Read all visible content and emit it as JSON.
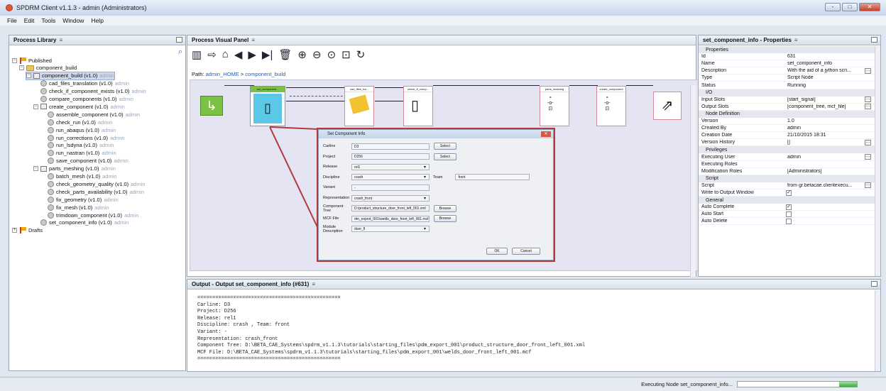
{
  "window": {
    "title": "SPDRM Client v1.1.3 - admin (Administrators)",
    "controls": [
      "-",
      "□",
      "✕"
    ]
  },
  "menu": [
    "File",
    "Edit",
    "Tools",
    "Window",
    "Help"
  ],
  "library": {
    "title": "Process Library",
    "close": "≡",
    "search_icon": "search-icon",
    "tree": [
      {
        "label": "Published",
        "icon": "flag",
        "depth": 0,
        "tog": "−"
      },
      {
        "label": "component_build",
        "icon": "folder",
        "depth": 1,
        "tog": "−"
      },
      {
        "label": "component_build (v1.0)",
        "user": "admin",
        "icon": "proc",
        "depth": 2,
        "tog": "−",
        "selected": true
      },
      {
        "label": "cad_files_translation (v1.0)",
        "user": "admin",
        "icon": "gear",
        "depth": 3
      },
      {
        "label": "check_if_component_exists (v1.0)",
        "user": "admin",
        "icon": "gear",
        "depth": 3
      },
      {
        "label": "compare_components (v1.0)",
        "user": "admin",
        "icon": "gear",
        "depth": 3
      },
      {
        "label": "create_component (v1.0)",
        "user": "admin",
        "icon": "proc",
        "depth": 3,
        "tog": "−"
      },
      {
        "label": "assemble_component (v1.0)",
        "user": "admin",
        "icon": "gear",
        "depth": 4
      },
      {
        "label": "check_run (v1.0)",
        "user": "admin",
        "icon": "gear",
        "depth": 4
      },
      {
        "label": "run_abaqus (v1.0)",
        "user": "admin",
        "icon": "gear",
        "depth": 4
      },
      {
        "label": "run_corrections (v1.0)",
        "user": "admin",
        "icon": "gear",
        "depth": 4
      },
      {
        "label": "run_lsdyna (v1.0)",
        "user": "admin",
        "icon": "gear",
        "depth": 4
      },
      {
        "label": "run_nastran (v1.0)",
        "user": "admin",
        "icon": "gear",
        "depth": 4
      },
      {
        "label": "save_component (v1.0)",
        "user": "admin",
        "icon": "gear",
        "depth": 4
      },
      {
        "label": "parts_meshing (v1.0)",
        "user": "admin",
        "icon": "proc",
        "depth": 3,
        "tog": "−"
      },
      {
        "label": "batch_mesh (v1.0)",
        "user": "admin",
        "icon": "gear",
        "depth": 4
      },
      {
        "label": "check_geometry_quality (v1.0)",
        "user": "admin",
        "icon": "gear",
        "depth": 4
      },
      {
        "label": "check_parts_availability (v1.0)",
        "user": "admin",
        "icon": "gear",
        "depth": 4
      },
      {
        "label": "fix_geometry (v1.0)",
        "user": "admin",
        "icon": "gear",
        "depth": 4
      },
      {
        "label": "fix_mesh (v1.0)",
        "user": "admin",
        "icon": "gear",
        "depth": 4
      },
      {
        "label": "trimdown_component (v1.0)",
        "user": "admin",
        "icon": "gear",
        "depth": 4
      },
      {
        "label": "set_component_info (v1.0)",
        "user": "admin",
        "icon": "gear",
        "depth": 3
      },
      {
        "label": "Drafts",
        "icon": "flag",
        "depth": 0,
        "tog": "+"
      }
    ]
  },
  "visual": {
    "title": "Process Visual Panel",
    "close": "≡",
    "path_label": "Path:",
    "path_home": "admin_HOME",
    "path_sep": ">",
    "path_current": "component_build",
    "toolbar": [
      "▥",
      "⇨",
      "⌂",
      "◀",
      "▶",
      "▶|",
      "🗑",
      "⊕",
      "⊖",
      "⊙",
      "⊡",
      "↻"
    ],
    "nodes": [
      "set_component...",
      "cad_files_tra...",
      "check_if_comp...",
      "parts_meshing",
      "create_component"
    ]
  },
  "dialog": {
    "title": "Set Component Info",
    "close": "✕",
    "fields": [
      {
        "label": "Carline",
        "value": "D3",
        "button": "Select"
      },
      {
        "label": "Project",
        "value": "D256",
        "button": "Select"
      },
      {
        "label": "Release",
        "value": "rel1",
        "combo": true
      },
      {
        "label": "Discipline",
        "value": "crash",
        "combo": true,
        "extra_label": "Team",
        "extra_value": "front"
      },
      {
        "label": "Variant",
        "value": "-"
      },
      {
        "label": "Representation",
        "value": "crash_front",
        "combo": true
      },
      {
        "label": "Component Tree",
        "value": "D:\\product_structure_door_front_left_001.xml",
        "button": "Browse"
      },
      {
        "label": "MCF File",
        "value": "dm_export_001\\welds_door_front_left_001.mcf",
        "button": "Browse"
      },
      {
        "label": "Module Description",
        "value": "door_fl",
        "combo": true
      }
    ],
    "ok": "OK",
    "cancel": "Cancel"
  },
  "properties": {
    "title": "set_component_info - Properties",
    "close": "≡",
    "rows": [
      {
        "section": "Properties"
      },
      {
        "k": "Id",
        "v": "631"
      },
      {
        "k": "Name",
        "v": "set_component_info"
      },
      {
        "k": "Description",
        "v": "With the aid of a jython scri...",
        "btn": true
      },
      {
        "k": "Type",
        "v": "Script Node"
      },
      {
        "k": "Status",
        "v": "Running"
      },
      {
        "section": "I/O"
      },
      {
        "k": "Input Slots",
        "v": "[start_signal]",
        "btn": true
      },
      {
        "k": "Output Slots",
        "v": "[component_tree, mcf_file]",
        "btn": true
      },
      {
        "section": "Node Definition"
      },
      {
        "k": "Version",
        "v": "1.0"
      },
      {
        "k": "Created By",
        "v": "admin"
      },
      {
        "k": "Creation Date",
        "v": "21/10/2015 18:31"
      },
      {
        "k": "Version History",
        "v": "[]",
        "btn": true
      },
      {
        "section": "Privileges"
      },
      {
        "k": "Executing User",
        "v": "admin",
        "btn": true
      },
      {
        "k": "Executing Roles",
        "v": ""
      },
      {
        "k": "Modification Roles",
        "v": "[Administrators]"
      },
      {
        "section": "Script"
      },
      {
        "k": "Script",
        "v": "from gr.betacae.clientexecu...",
        "btn": true
      },
      {
        "k": "Write to Output Window",
        "chk": "✓"
      },
      {
        "section": "General"
      },
      {
        "k": "Auto Complete",
        "chk": "✓"
      },
      {
        "k": "Auto Start",
        "chk": ""
      },
      {
        "k": "Auto Delete",
        "chk": ""
      }
    ]
  },
  "output": {
    "title": "Output - Output set_component_info (#631)",
    "close": "≡",
    "lines": [
      "================================================",
      "Carline: D3",
      "Project: D256",
      "Release: rel1",
      "Discipline: crash , Team: front",
      "Variant: -",
      "Representation: crash_front",
      "Component Tree: D:\\BETA_CAE_Systems\\spdrm_v1.1.3\\tutorials\\starting_files\\pdm_export_001\\product_structure_door_front_left_001.xml",
      "MCF File: D:\\BETA_CAE_Systems\\spdrm_v1.1.3\\tutorials\\starting_files\\pdm_export_001\\welds_door_front_left_001.mcf",
      "================================================"
    ]
  },
  "status": {
    "text": "Executing Node set_component_info...",
    "progress": 0.15
  }
}
